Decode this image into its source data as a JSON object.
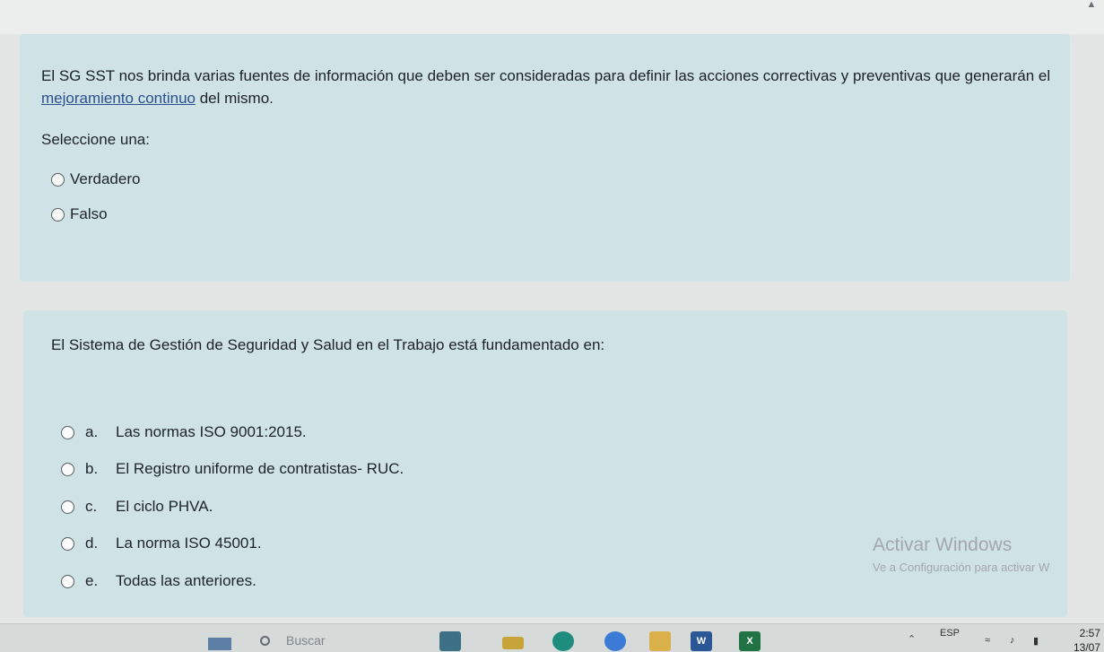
{
  "question1": {
    "text_before": "El SG SST nos brinda varias fuentes de información que deben ser consideradas para definir las acciones correctivas y preventivas que generarán el ",
    "link_text": "mejoramiento continuo",
    "text_after": " del mismo.",
    "select_label": "Seleccione una:",
    "options": [
      "Verdadero",
      "Falso"
    ]
  },
  "question2": {
    "text": "El Sistema de Gestión de Seguridad y Salud en el Trabajo está fundamentado en:",
    "options": [
      {
        "letter": "a.",
        "label": "Las normas ISO 9001:2015."
      },
      {
        "letter": "b.",
        "label": "El Registro uniforme de contratistas- RUC."
      },
      {
        "letter": "c.",
        "label": "El ciclo PHVA."
      },
      {
        "letter": "d.",
        "label": "La norma ISO 45001."
      },
      {
        "letter": "e.",
        "label": "Todas las anteriores."
      }
    ]
  },
  "watermark": {
    "title": "Activar Windows",
    "subtitle": "Ve a Configuración para activar W"
  },
  "taskbar": {
    "search_placeholder": "Buscar",
    "apps": [
      {
        "icon": "word-icon",
        "label": "W",
        "color": "#2b5797"
      },
      {
        "icon": "excel-icon",
        "label": "X",
        "color": "#217346"
      }
    ],
    "language": "ESP",
    "time": "2:57",
    "date": "13/07"
  }
}
